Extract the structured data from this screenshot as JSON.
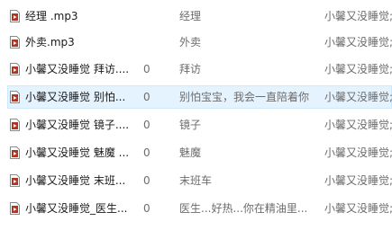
{
  "icons": {
    "file": "media-file-icon"
  },
  "colors": {
    "selected_bg": "#e5f3ff",
    "selected_border": "#cce8ff",
    "icon_accent": "#b2341f"
  },
  "rows": [
    {
      "name": "经理 .mp3",
      "number": "",
      "title": "经理",
      "artist": "小馨又没睡觉;"
    },
    {
      "name": "外卖.mp3",
      "number": "",
      "title": "外卖",
      "artist": "小馨又没睡觉;"
    },
    {
      "name": "小馨又没睡觉 拜访....",
      "number": "0",
      "title": "拜访",
      "artist": "小馨又没睡觉;"
    },
    {
      "name": "小馨又没睡觉 别怕...",
      "number": "0",
      "title": "别怕宝宝，我会一直陪着你",
      "artist": "小馨又没睡觉;"
    },
    {
      "name": "小馨又没睡觉 镜子....",
      "number": "0",
      "title": "镜子",
      "artist": "小馨又没睡觉;"
    },
    {
      "name": "小馨又没睡觉 魅魔 ...",
      "number": "0",
      "title": "魅魔",
      "artist": "小馨又没睡觉;"
    },
    {
      "name": "小馨又没睡觉 末班...",
      "number": "0",
      "title": "末班车",
      "artist": "小馨又没睡觉;"
    },
    {
      "name": "小馨又没睡觉_医生...",
      "number": "0",
      "title": "医生...好热...你在精油里...",
      "artist": "小馨又没睡觉;"
    }
  ]
}
